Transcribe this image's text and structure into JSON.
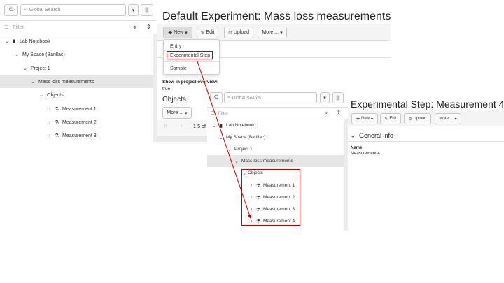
{
  "left": {
    "search_placeholder": "Global Search",
    "filter_placeholder": "Filter",
    "tree": [
      {
        "label": "Lab Notebook"
      },
      {
        "label": "My Space (Barillac)"
      },
      {
        "label": "Project 1"
      },
      {
        "label": "Mass loss measurements"
      },
      {
        "label": "Objects"
      },
      {
        "label": "Measurement 1"
      },
      {
        "label": "Measurement 2"
      },
      {
        "label": "Measurement 3"
      }
    ]
  },
  "main": {
    "title": "Default Experiment: Mass loss measurements",
    "buttons": {
      "new": "New",
      "edit": "Edit",
      "upload": "Upload",
      "more": "More ..."
    },
    "new_menu": [
      "Entry",
      "Experimental Step",
      "Sample"
    ],
    "show_overview_label": "Show in project overview:",
    "show_overview_value": "true",
    "objects_title": "Objects",
    "objects_more": "More ...",
    "pager_text": "1-5 of"
  },
  "overlay": {
    "search_placeholder": "Global Search",
    "filter_placeholder": "Filter",
    "tree": [
      {
        "label": "Lab Notebook"
      },
      {
        "label": "My Space (Barillac)"
      },
      {
        "label": "Project 1"
      },
      {
        "label": "Mass loss measurements"
      },
      {
        "label": "Objects"
      },
      {
        "label": "Measurement 1"
      },
      {
        "label": "Measurement 2"
      },
      {
        "label": "Measurement 3"
      },
      {
        "label": "Measurement 4"
      }
    ]
  },
  "right": {
    "title": "Experimental Step: Measurement 4",
    "buttons": {
      "new": "New",
      "edit": "Edit",
      "upload": "Upload",
      "more": "More ..."
    },
    "section": "General info",
    "name_label": "Name:",
    "name_value": "Measurement 4"
  },
  "icons": {
    "power": "power-icon",
    "search": "search-icon",
    "dropdown": "caret-down-icon",
    "barcode": "barcode-icon",
    "filter": "filter-icon",
    "locate": "locate-icon",
    "collapse": "collapse-all-icon",
    "notebook": "notebook-icon",
    "flask": "flask-icon"
  },
  "colors": {
    "highlight_red": "#c00000",
    "selected_row": "#e6e6e6"
  }
}
